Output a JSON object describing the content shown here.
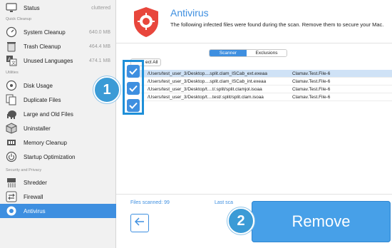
{
  "sidebar": {
    "top_item": {
      "label": "Status",
      "value": "cluttered"
    },
    "sections": [
      {
        "label": "Quick Cleanup"
      },
      {
        "label": "Utilities"
      },
      {
        "label": "Security and Privacy"
      }
    ],
    "cleanup_items": [
      {
        "label": "System Cleanup",
        "value": "640.0 MB"
      },
      {
        "label": "Trash Cleanup",
        "value": "464.4 MB"
      },
      {
        "label": "Unused Languages",
        "value": "474.1 MB"
      }
    ],
    "utility_items": [
      {
        "label": "Disk Usage"
      },
      {
        "label": "Duplicate Files"
      },
      {
        "label": "Large and Old Files"
      },
      {
        "label": "Uninstaller"
      },
      {
        "label": "Memory Cleanup"
      },
      {
        "label": "Startup Optimization"
      }
    ],
    "security_items": [
      {
        "label": "Shredder"
      },
      {
        "label": "Firewall"
      },
      {
        "label": "Antivirus"
      }
    ]
  },
  "main": {
    "title": "Antivirus",
    "subtitle": "The following infected files were found during the scan. Remove them to secure your Mac.",
    "tabs": [
      {
        "label": "Scanner"
      },
      {
        "label": "Exclusions"
      }
    ],
    "select_all_label": "ect All",
    "files": [
      {
        "path": "/Users/test_user_3/Desktop....split.clam_ISCab_ext.exeaa",
        "threat": "Clamav.Test.File-6"
      },
      {
        "path": "/Users/test_user_3/Desktop....split.clam_ISCab_int.exeaa",
        "threat": "Clamav.Test.File-6"
      },
      {
        "path": "/Users/test_user_3/Desktop/t....t/.split/split.clamjol.isoaa",
        "threat": "Clamav.Test.File-6"
      },
      {
        "path": "/Users/test_user_3/Desktop/t....test/.split/split.clam.isoaa",
        "threat": "Clamav.Test.File-6"
      }
    ],
    "files_scanned": "Files scanned: 99",
    "last_scan": "Last sca",
    "remove_label": "Remove"
  },
  "annotations": {
    "step1": "1",
    "step2": "2"
  },
  "colors": {
    "accent": "#3e8fe0",
    "sidebar_bg": "#f1f1f1",
    "shield_red": "#e8463c",
    "badge": "#3b9bd6"
  }
}
